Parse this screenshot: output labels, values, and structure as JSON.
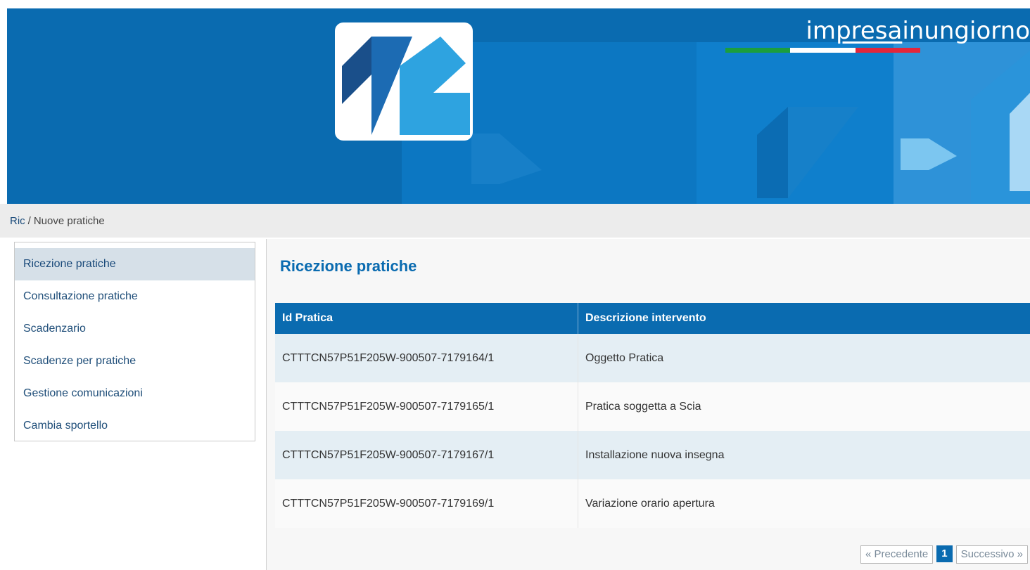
{
  "header": {
    "brand": {
      "pre": "im",
      "mid": "presa",
      "post": "inungiorno"
    },
    "flag_colors": [
      "#1b9e3e",
      "#ffffff",
      "#e3263b"
    ]
  },
  "breadcrumb": {
    "root": "Ric",
    "separator": "/",
    "current": "Nuove pratiche"
  },
  "sidebar": {
    "items": [
      {
        "label": "Ricezione pratiche",
        "active": true
      },
      {
        "label": "Consultazione pratiche"
      },
      {
        "label": "Scadenzario"
      },
      {
        "label": "Scadenze per pratiche"
      },
      {
        "label": "Gestione comunicazioni"
      },
      {
        "label": "Cambia sportello"
      }
    ]
  },
  "main": {
    "title": "Ricezione pratiche",
    "table": {
      "columns": [
        "Id Pratica",
        "Descrizione intervento"
      ],
      "rows": [
        [
          "CTTTCN57P51F205W-900507-7179164/1",
          "Oggetto Pratica"
        ],
        [
          "CTTTCN57P51F205W-900507-7179165/1",
          "Pratica soggetta a Scia"
        ],
        [
          "CTTTCN57P51F205W-900507-7179167/1",
          "Installazione nuova insegna"
        ],
        [
          "CTTTCN57P51F205W-900507-7179169/1",
          "Variazione orario apertura"
        ]
      ]
    },
    "pager": {
      "prev": "« Precedente",
      "current": "1",
      "next": "Successivo »"
    }
  }
}
